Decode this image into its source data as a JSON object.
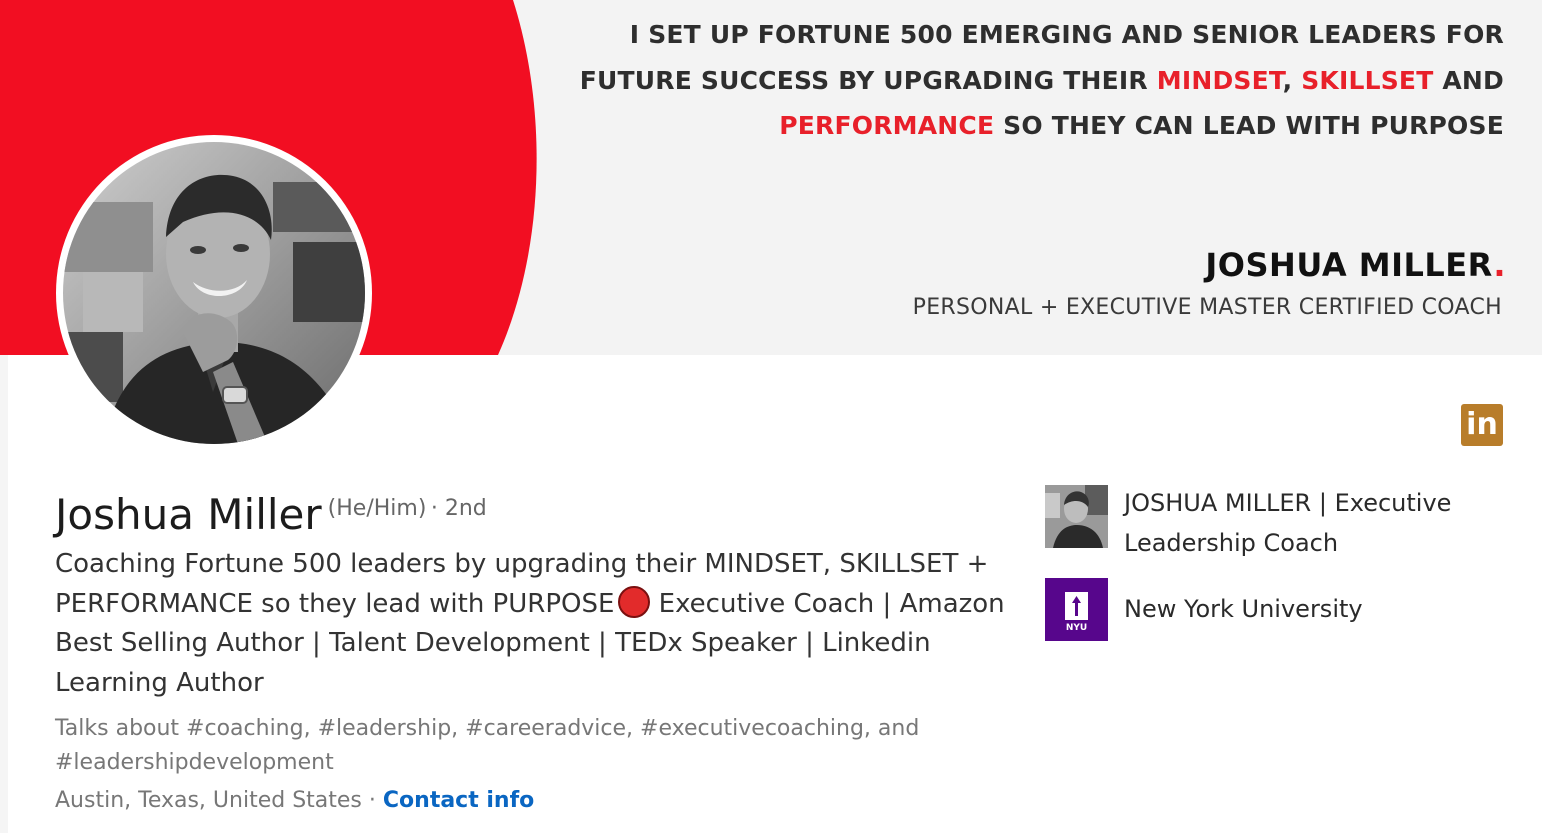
{
  "banner": {
    "headline_parts": {
      "line1": "I SET UP FORTUNE 500 EMERGING AND SENIOR LEADERS FOR",
      "line2_pre": "FUTURE SUCCESS BY UPGRADING THEIR ",
      "mindset": "MINDSET",
      "comma": ", ",
      "skillset": "SKILLSET",
      "and": " AND",
      "performance": "PERFORMANCE",
      "line3_post": " SO THEY CAN LEAD WITH PURPOSE"
    },
    "name": "JOSHUA MILLER",
    "name_dot": ".",
    "title": "PERSONAL + EXECUTIVE MASTER CERTIFIED COACH",
    "linkedin_badge": "in",
    "accent_color": "#e8202a"
  },
  "profile": {
    "name": "Joshua Miller",
    "pronouns": "(He/Him)",
    "degree": "· 2nd",
    "headline_part1": "Coaching Fortune 500 leaders by upgrading their MINDSET, SKILLSET + PERFORMANCE so they lead with PURPOSE",
    "headline_part2": "Executive Coach | Amazon Best Selling Author | Talent Development | TEDx Speaker | Linkedin Learning Author",
    "talks_about": "Talks about #coaching, #leadership, #careeradvice, #executivecoaching, and #leadershipdevelopment",
    "location": "Austin, Texas, United States",
    "separator": " · ",
    "contact_info": "Contact info",
    "link_color": "#0a66c2"
  },
  "sidebar": {
    "company": "JOSHUA MILLER | Executive Leadership Coach",
    "school": "New York University",
    "school_logo_text": "NYU",
    "school_color": "#57068c"
  },
  "icons": {
    "linkedin": "linkedin-icon",
    "status": "red-circle-icon"
  }
}
